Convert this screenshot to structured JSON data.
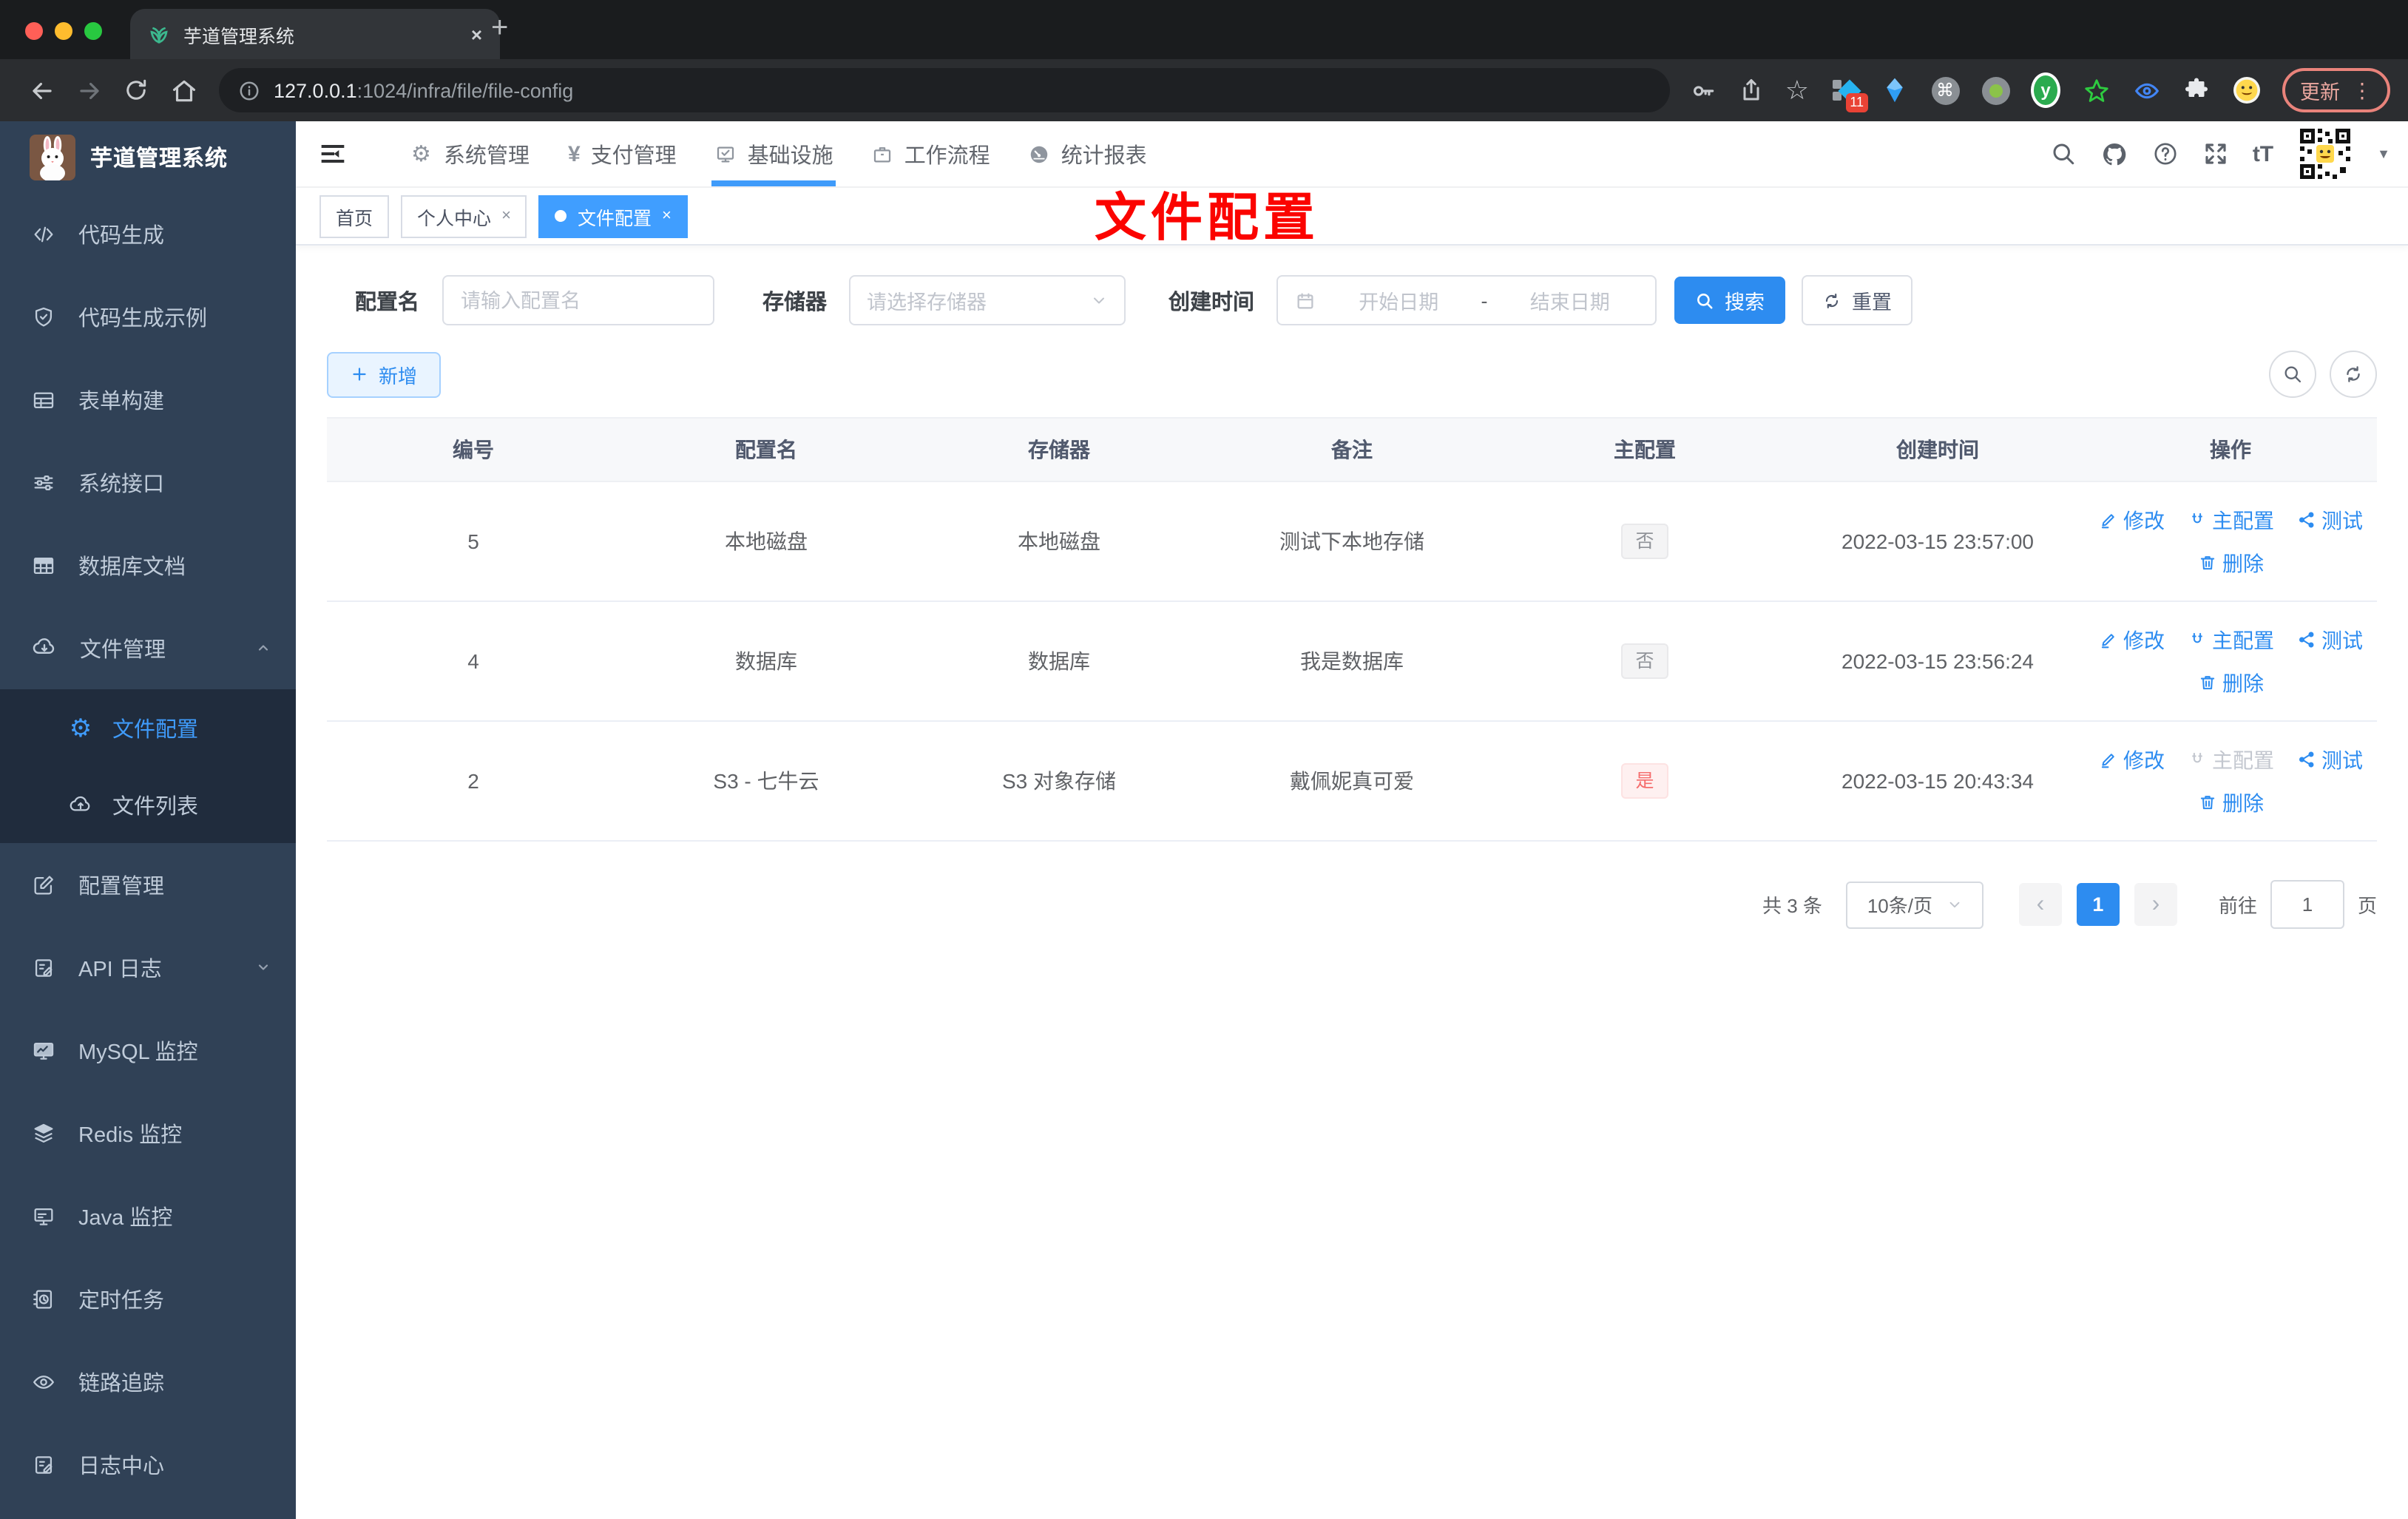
{
  "colors": {
    "accent": "#2d8cf0",
    "tag_active_bg": "#409eff",
    "danger_text": "#f56c6c",
    "danger_bg": "#fef0f0",
    "info_text": "#909399",
    "info_bg": "#f4f4f5",
    "sidebar_bg": "#304156",
    "submenu_bg": "#202c3d",
    "annotation_red": "#fb0400",
    "search_button_bg": "#2d8cf0"
  },
  "icons": {
    "gear_glyph": "⚙",
    "caret_down_glyph": "▼",
    "star_glyph": "☆",
    "command_glyph": "⌘"
  },
  "browser": {
    "tab_title": "芋道管理系统",
    "tab_close": "×",
    "new_tab": "+",
    "url_host": "127.0.0.1",
    "url_path": ":1024/infra/file/file-config",
    "ext_badge": "11",
    "ext_y_label": "y",
    "update_label": "更新",
    "menu_dots": "⋮"
  },
  "sidebar": {
    "title": "芋道管理系统",
    "items": [
      {
        "label": "代码生成"
      },
      {
        "label": "代码生成示例"
      },
      {
        "label": "表单构建"
      },
      {
        "label": "系统接口"
      },
      {
        "label": "数据库文档"
      },
      {
        "label": "文件管理"
      },
      {
        "label": "文件配置"
      },
      {
        "label": "文件列表"
      },
      {
        "label": "配置管理"
      },
      {
        "label": "API 日志"
      },
      {
        "label": "MySQL 监控"
      },
      {
        "label": "Redis 监控"
      },
      {
        "label": "Java 监控"
      },
      {
        "label": "定时任务"
      },
      {
        "label": "链路追踪"
      },
      {
        "label": "日志中心"
      }
    ]
  },
  "topnav": {
    "items": [
      {
        "label": "系统管理"
      },
      {
        "label": "支付管理"
      },
      {
        "label": "基础设施"
      },
      {
        "label": "工作流程"
      },
      {
        "label": "统计报表"
      }
    ],
    "yen_glyph": "¥"
  },
  "tags": {
    "items": [
      {
        "label": "首页"
      },
      {
        "label": "个人中心",
        "close": "×"
      },
      {
        "label": "文件配置",
        "close": "×"
      }
    ]
  },
  "annotation": {
    "text": "文件配置"
  },
  "filter": {
    "name_label": "配置名",
    "name_placeholder": "请输入配置名",
    "storage_label": "存储器",
    "storage_placeholder": "请选择存储器",
    "time_label": "创建时间",
    "start_placeholder": "开始日期",
    "range_separator": "-",
    "end_placeholder": "结束日期",
    "search_label": "搜索",
    "reset_label": "重置"
  },
  "toolbar": {
    "add_label": "新增"
  },
  "table": {
    "headers": [
      "编号",
      "配置名",
      "存储器",
      "备注",
      "主配置",
      "创建时间",
      "操作"
    ],
    "actions": {
      "edit": "修改",
      "master": "主配置",
      "test": "测试",
      "delete": "删除"
    },
    "rows": [
      {
        "id": "5",
        "name": "本地磁盘",
        "storage": "本地磁盘",
        "remark": "测试下本地存储",
        "master": "否",
        "master_type": "info",
        "master_state": "enabled",
        "created": "2022-03-15 23:57:00"
      },
      {
        "id": "4",
        "name": "数据库",
        "storage": "数据库",
        "remark": "我是数据库",
        "master": "否",
        "master_type": "info",
        "master_state": "enabled",
        "created": "2022-03-15 23:56:24"
      },
      {
        "id": "2",
        "name": "S3 - 七牛云",
        "storage": "S3 对象存储",
        "remark": "戴佩妮真可爱",
        "master": "是",
        "master_type": "danger",
        "master_state": "disabled",
        "created": "2022-03-15 20:43:34"
      }
    ]
  },
  "pagination": {
    "total": "共 3 条",
    "page_size": "10条/页",
    "prev": "‹",
    "current_page": "1",
    "next": "›",
    "goto_label": "前往",
    "goto_value": "1",
    "unit": "页"
  }
}
